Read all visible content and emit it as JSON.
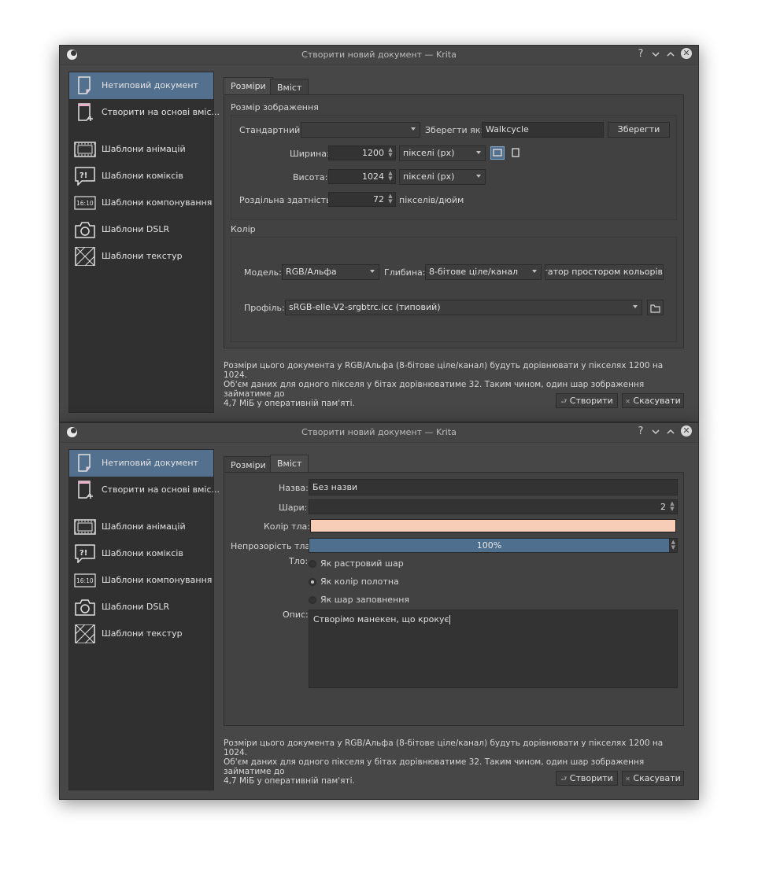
{
  "window_title": "Створити новий документ — Krita",
  "titlebar_buttons": {
    "help": "?",
    "minimize": "⌄",
    "maximize": "⌃",
    "close": "✕"
  },
  "sidebar": {
    "items": [
      {
        "label": "Нетиповий документ",
        "icon": "blank-document-icon"
      },
      {
        "label": "Створити на основі вміс...",
        "icon": "new-from-clipboard-icon"
      },
      {
        "label": "Шаблони анімацій",
        "icon": "animation-template-icon"
      },
      {
        "label": "Шаблони комiксів",
        "icon": "comic-template-icon"
      },
      {
        "label": "Шаблони компонування",
        "icon": "layout-template-icon"
      },
      {
        "label": "Шаблони DSLR",
        "icon": "camera-icon"
      },
      {
        "label": "Шаблони текстур",
        "icon": "texture-icon"
      }
    ],
    "layout_icon_text": "16:10",
    "comic_icon_text": "?!"
  },
  "tabs": {
    "dimensions": "Розміри",
    "content": "Вміст"
  },
  "dimensions": {
    "image_size_group": "Розмір зображення",
    "predefined_label": "Стандартний:",
    "predefined_value": "",
    "save_as_label": "Зберегти як:",
    "save_as_value": "Walkcycle",
    "save_button": "Зберегти",
    "width_label": "Ширина:",
    "width_value": "1200",
    "width_unit": "пікселі (px)",
    "height_label": "Висота:",
    "height_value": "1024",
    "height_unit": "пікселі (px)",
    "resolution_label": "Роздільна здатність:",
    "resolution_value": "72",
    "resolution_unit": "пікселів/дюйм",
    "color_group": "Колір",
    "model_label": "Модель:",
    "model_value": "RGB/Альфа",
    "depth_label": "Глибина:",
    "depth_value": "8-бітове ціле/канал",
    "color_space_browser": "Навігатор простором кольорів",
    "profile_label": "Профіль:",
    "profile_value": "sRGB-elle-V2-srgbtrc.icc (типовий)"
  },
  "content": {
    "name_label": "Назва:",
    "name_value": "Без назви",
    "layers_label": "Шари:",
    "layers_value": "2",
    "bg_color_label": "Колір тла:",
    "bg_color_hex": "#f7cdb8",
    "opacity_label": "Непрозорість тла:",
    "opacity_value": "100%",
    "opacity_fraction": 1.0,
    "background_label": "Тло:",
    "bg_options": [
      "Як растровий шар",
      "Як колір полотна",
      "Як шар заповнення"
    ],
    "bg_selected_index": 1,
    "description_label": "Опис:",
    "description_value": "Створімо манекен, що крокує"
  },
  "info_text": {
    "line1": "Розміри цього документа у RGB/Альфа (8-бітове ціле/канал) будуть дорівнювати у пікселях 1200 на 1024.",
    "line2": "Об'єм даних для одного пікселя у бітах дорівнюватиме 32. Таким чином, один шар зображення займатиме до",
    "line3": "4,7 МіБ у оперативній пам'яті."
  },
  "buttons": {
    "create": "Створити",
    "cancel": "Скасувати",
    "create_icon": "⮐",
    "cancel_icon": "✕"
  },
  "colors": {
    "selection": "#53718f",
    "panel_bg": "#474747",
    "sidebar_bg": "#303030"
  }
}
